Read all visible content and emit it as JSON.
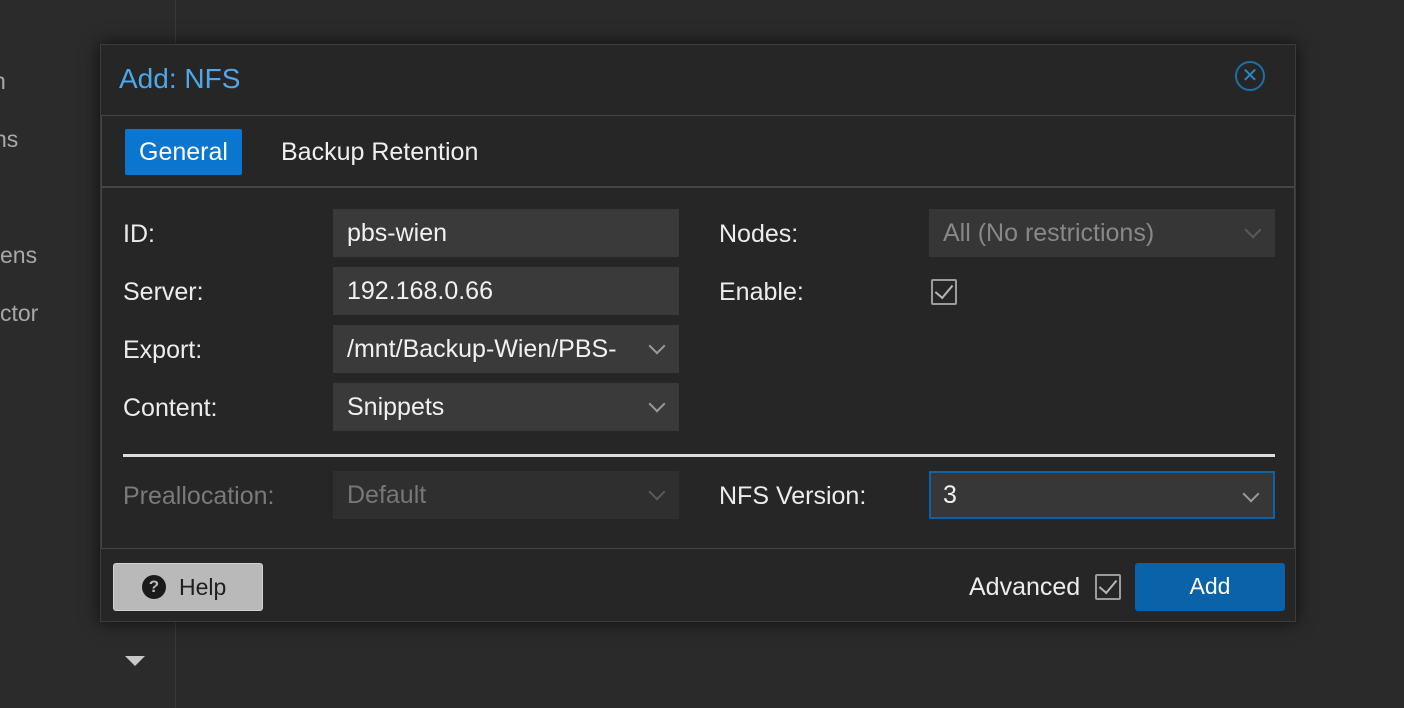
{
  "background": {
    "sidebar_fragments": [
      "n",
      "ns",
      "ens",
      "ctor"
    ]
  },
  "dialog": {
    "title": "Add: NFS",
    "tabs": [
      {
        "label": "General",
        "active": true
      },
      {
        "label": "Backup Retention",
        "active": false
      }
    ],
    "fields": {
      "id": {
        "label": "ID:",
        "value": "pbs-wien"
      },
      "server": {
        "label": "Server:",
        "value": "192.168.0.66"
      },
      "export": {
        "label": "Export:",
        "value": "/mnt/Backup-Wien/PBS-"
      },
      "content": {
        "label": "Content:",
        "value": "Snippets"
      },
      "nodes": {
        "label": "Nodes:",
        "value": "All (No restrictions)"
      },
      "enable": {
        "label": "Enable:",
        "checked": true
      },
      "preallocation": {
        "label": "Preallocation:",
        "value": "Default"
      },
      "nfs_version": {
        "label": "NFS Version:",
        "value": "3"
      }
    },
    "footer": {
      "help_label": "Help",
      "advanced_label": "Advanced",
      "advanced_checked": true,
      "add_label": "Add"
    }
  },
  "colors": {
    "accent": "#0a76cf",
    "title": "#4fa6e8",
    "add_button": "#0a63a8"
  }
}
